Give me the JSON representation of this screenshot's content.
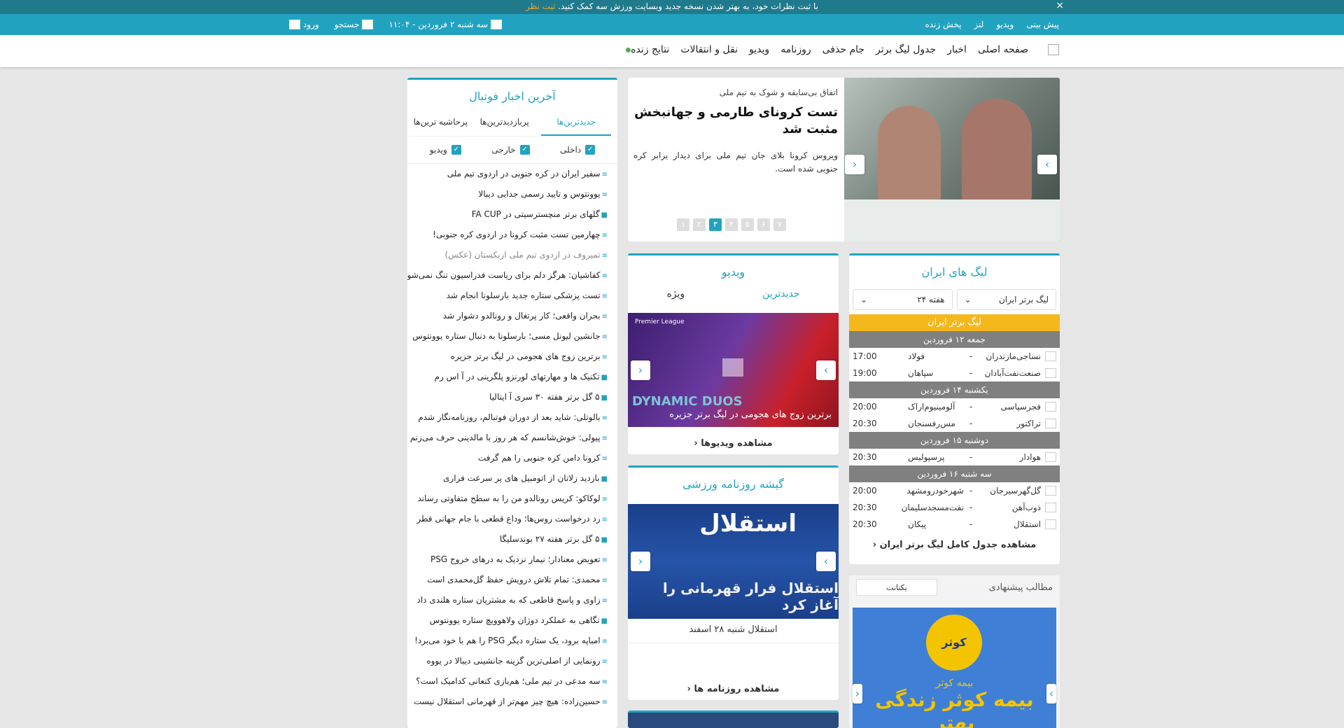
{
  "topbar": {
    "message": "با ثبت نظرات خود، به بهتر شدن نسخه جدید وبسایت ورزش سه کمک کنید.",
    "link": "ثبت نظر",
    "close": "×"
  },
  "subnav": {
    "links": [
      "پیش بینی",
      "ویدیو",
      "لنز",
      "پخش زنده"
    ],
    "date": "سه شنبه ۲ فروردین - ۱۱:۰۴",
    "search": "جستجو",
    "login": "ورود"
  },
  "mainnav": {
    "items": [
      "صفحه اصلی",
      "اخبار",
      "جدول لیگ برتر",
      "جام حذفی",
      "روزنامه",
      "ویدیو",
      "نقل و انتقالات",
      "نتایج زنده"
    ]
  },
  "news": {
    "title": "آخرین اخبار فوتبال",
    "tabs": [
      "جدیدترین‌ها",
      "پربازدیدترین‌ها",
      "پرحاشیه ترین‌ها"
    ],
    "filters": [
      "داخلی",
      "خارجی",
      "ویدیو"
    ],
    "items": [
      {
        "icon": "≡",
        "text": "سفیر ایران در کره جنوبی در اردوی تیم ملی"
      },
      {
        "icon": "≡",
        "text": "یوونتوس و تایید رسمی جدایی دیبالا"
      },
      {
        "icon": "■",
        "text": "گلهای برتر منچسترسیتی در FA CUP"
      },
      {
        "icon": "≡",
        "text": "چهارمین تست مثبت کرونا در اردوی کره جنوبی!"
      },
      {
        "icon": "≡",
        "text": "تمیروف در اردوی تیم ملی ازبکستان (عکس)"
      },
      {
        "icon": "≡",
        "text": "کفاشیان: هرگز دلم برای ریاست فدراسیون تنگ نمی‌شود"
      },
      {
        "icon": "≡",
        "text": "تست پزشکی ستاره جدید بارسلونا انجام شد"
      },
      {
        "icon": "≡",
        "text": "بحران واقعی؛ کار پرتغال و رونالدو دشوار شد"
      },
      {
        "icon": "≡",
        "text": "جانشین لیونل مسی؛ بارسلونا به دنبال ستاره یوونتوس"
      },
      {
        "icon": "≡",
        "text": "برترین زوج های هجومی در لیگ برتر جزیره"
      },
      {
        "icon": "■",
        "text": "تکنیک ها و مهارتهای لورنزو پلگرینی در آ اس رم"
      },
      {
        "icon": "■",
        "text": "۵ گل برتر هفته ۳۰ سری آ ایتالیا"
      },
      {
        "icon": "≡",
        "text": "بالوتلی: شاید بعد از دوران فوتبالم، روزنامه‌نگار شدم"
      },
      {
        "icon": "≡",
        "text": "پیولی: خوش‌شانسم که هر روز با مالدینی حرف می‌زنم"
      },
      {
        "icon": "≡",
        "text": "کرونا دامن کره جنوبی را هم گرفت"
      },
      {
        "icon": "■",
        "text": "بازدید زلاتان از اتومبیل های پر سرعت فراری"
      },
      {
        "icon": "≡",
        "text": "لوکاکو: کریس رونالدو من را به سطح متفاوتی رساند"
      },
      {
        "icon": "≡",
        "text": "رد درخواست روس‌ها؛ وداع قطعی با جام جهانی قطر"
      },
      {
        "icon": "■",
        "text": "۵ گل برتر هفته ۲۷ بوندسلیگا"
      },
      {
        "icon": "≡",
        "text": "تعویض معنادار؛ نیمار نزدیک به درهای خروج PSG"
      },
      {
        "icon": "≡",
        "text": "محمدی: تمام تلاش درویش حفظ گل‌محمدی است"
      },
      {
        "icon": "≡",
        "text": "زاوی و پاسخ قاطعی که به مشتریان ستاره هلندی داد"
      },
      {
        "icon": "■",
        "text": "نگاهی به عملکرد دوژان ولاهوویچ ستاره یوونتوس"
      },
      {
        "icon": "≡",
        "text": "امباپه برود، یک ستاره دیگر PSG را هم با خود می‌برد!"
      },
      {
        "icon": "≡",
        "text": "رونمایی از اصلی‌ترین گزینه جانشینی دیبالا در یووه"
      },
      {
        "icon": "≡",
        "text": "سه مدعی در تیم ملی؛ هم‌بازی کنعانی کدامیک است؟"
      },
      {
        "icon": "≡",
        "text": "حسین‌زاده: هیچ چیز مهم‌تر از قهرمانی استقلال نیست"
      }
    ]
  },
  "slider": {
    "kicker": "اتفاق بی‌سابقه و شوک به تیم ملی",
    "headline": "تست کرونای طارمی و جهانبخش مثبت شد",
    "lead": "ویروس کرونا بلای جان تیم ملی برای دیدار برابر کره جنوبی شده است.",
    "dots": [
      "۷",
      "۶",
      "۵",
      "۴",
      "۳",
      "۲",
      "۱"
    ],
    "active_dot": "۳"
  },
  "leagues": {
    "title": "لیگ های ایران",
    "league_select": "لیگ برتر ایران",
    "week_select": "هفته ۲۴",
    "league_header": "لیگ برتر ایران",
    "days": [
      {
        "label": "جمعه ۱۲ فروردین",
        "matches": [
          {
            "home": "نساجی‌مازندران",
            "away": "فولاد",
            "time": "17:00"
          },
          {
            "home": "صنعت‌نفت‌آبادان",
            "away": "سپاهان",
            "time": "19:00"
          }
        ]
      },
      {
        "label": "یکشنبه ۱۴ فروردین",
        "matches": [
          {
            "home": "فجرسپاسی",
            "away": "آلومینیوم‌اراک",
            "time": "20:00"
          },
          {
            "home": "تراکتور",
            "away": "مس‌رفسنجان",
            "time": "20:30"
          }
        ]
      },
      {
        "label": "دوشنبه ۱۵ فروردین",
        "matches": [
          {
            "home": "هوادار",
            "away": "پرسپولیس",
            "time": "20:30"
          }
        ]
      },
      {
        "label": "سه شنبه ۱۶ فروردین",
        "matches": [
          {
            "home": "گل‌گهرسیرجان",
            "away": "شهرخودرومشهد",
            "time": "20:00"
          },
          {
            "home": "ذوب‌آهن",
            "away": "نفت‌مسجدسلیمان",
            "time": "20:30"
          },
          {
            "home": "استقلال",
            "away": "پیکان",
            "time": "20:30"
          }
        ]
      }
    ],
    "more": "مشاهده جدول کامل لیگ برتر ایران"
  },
  "video": {
    "title": "ویدیو",
    "tabs": [
      "جدیدترین",
      "ویژه"
    ],
    "thumb_badge": "Premier League",
    "thumb_overlay": "DYNAMIC DUOS",
    "caption": "برترین زوج های هجومی در لیگ برتر جزیره",
    "more": "مشاهده ویدیوها"
  },
  "paper": {
    "title": "گیشه روزنامه ورزشی",
    "masthead": "استقلال",
    "headline": "استقلال فرار قهرمانی را آغاز کرد",
    "caption": "استقلال شنبه ۲۸ اسفند",
    "more": "مشاهده روزنامه ها"
  },
  "reco": {
    "title": "مطالب پیشنهادی",
    "logo": "یکتانت",
    "brand": "کوثر",
    "brand_sub": "بیمه کوثر",
    "slogan": "بیمه کوثر زندگی بهتر"
  },
  "colors": {
    "accent": "#21a3c0",
    "topbar": "#1f7a8c",
    "league_header": "#f5b81c"
  }
}
